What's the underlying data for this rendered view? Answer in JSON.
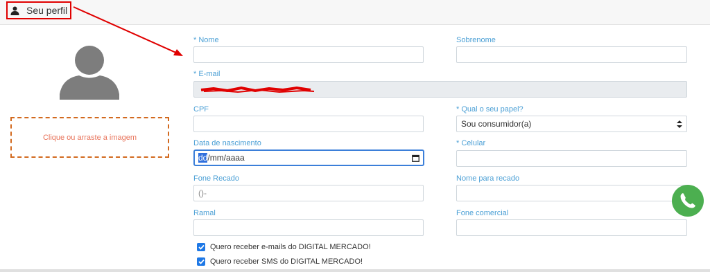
{
  "header": {
    "profile_tab_label": "Seu perfil"
  },
  "sidebar": {
    "upload_text": "Clique ou arraste a imagem"
  },
  "form": {
    "nome": {
      "label": "* Nome",
      "value": ""
    },
    "sobrenome": {
      "label": "Sobrenome",
      "value": ""
    },
    "email": {
      "label": "* E-mail",
      "value": ""
    },
    "cpf": {
      "label": "CPF",
      "value": ""
    },
    "papel": {
      "label": "* Qual o seu papel?",
      "value": "Sou consumidor(a)"
    },
    "nascimento": {
      "label": "Data de nascimento",
      "value_highlight": "dd",
      "value_rest": "/mm/aaaa"
    },
    "celular": {
      "label": "* Celular",
      "value": ""
    },
    "fone_recado": {
      "label": "Fone Recado",
      "value": "()-"
    },
    "nome_recado": {
      "label": "Nome para recado",
      "value": ""
    },
    "ramal": {
      "label": "Ramal",
      "value": ""
    },
    "fone_comercial": {
      "label": "Fone comercial",
      "value": ""
    },
    "checkbox_email": {
      "label": "Quero receber e-mails do DIGITAL MERCADO!",
      "checked": true
    },
    "checkbox_sms": {
      "label": "Quero receber SMS do DIGITAL MERCADO!",
      "checked": true
    }
  },
  "colors": {
    "accent": "#4a9fd5",
    "annotation": "#e00000",
    "checkbox": "#1e78e6",
    "whatsapp": "#4caf50"
  },
  "icons": [
    "user-icon",
    "avatar-placeholder-icon",
    "calendar-icon",
    "select-arrows-icon",
    "checkmark-icon",
    "whatsapp-icon"
  ]
}
